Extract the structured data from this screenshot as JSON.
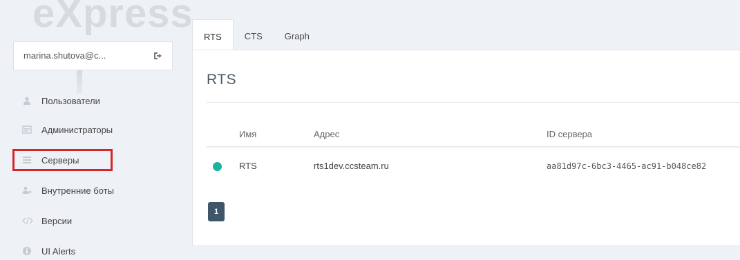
{
  "sidebar": {
    "logo": "eXpress",
    "user_email": "marina.shutova@c...",
    "items": [
      {
        "label": "Пользователи",
        "icon": "user-icon"
      },
      {
        "label": "Администраторы",
        "icon": "id-card-icon"
      },
      {
        "label": "Серверы",
        "icon": "list-icon"
      },
      {
        "label": "Внутренние боты",
        "icon": "bots-icon"
      },
      {
        "label": "Версии",
        "icon": "code-icon"
      },
      {
        "label": "UI Alerts",
        "icon": "info-icon"
      }
    ],
    "selected_item": "Серверы"
  },
  "tabs": [
    {
      "label": "RTS",
      "active": true
    },
    {
      "label": "CTS",
      "active": false
    },
    {
      "label": "Graph",
      "active": false
    }
  ],
  "panel": {
    "title": "RTS",
    "columns": [
      "Имя",
      "Адрес",
      "ID сервера"
    ],
    "rows": [
      {
        "status_color": "#1ab39c",
        "name": "RTS",
        "address": "rts1dev.ccsteam.ru",
        "server_id": "aa81d97c-6bc3-4465-ac91-b048ce82"
      }
    ],
    "pagination": {
      "current_page": "1"
    }
  },
  "colors": {
    "accent": "#3f5568",
    "status_online": "#1ab39c",
    "highlight": "#d6262b"
  }
}
